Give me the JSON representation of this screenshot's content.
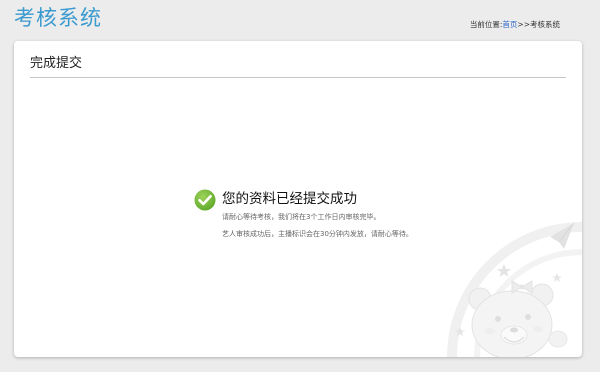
{
  "header": {
    "system_title": "考核系统",
    "breadcrumb": {
      "prefix": "当前位置:",
      "home_link": "首页",
      "separator": ">>",
      "current": "考核系统"
    }
  },
  "panel": {
    "title": "完成提交"
  },
  "result": {
    "icon": "check-circle-icon",
    "heading": "您的资料已经提交成功",
    "line1": "请耐心等待考核，我们将在3个工作日内审核完毕。",
    "line2": "艺人审核成功后，主播标识会在30分钟内发放，请耐心等待。"
  },
  "colors": {
    "title_blue": "#3a9ad0",
    "success_green": "#6ab430",
    "page_bg": "#ececec",
    "link_blue": "#2a64c8"
  }
}
